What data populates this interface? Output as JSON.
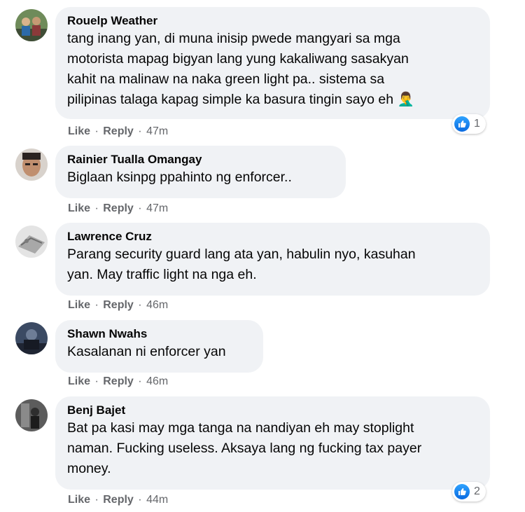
{
  "comments": [
    {
      "author": "Rouelp Weather",
      "text": "tang inang yan, di muna inisip pwede mangyari sa mga\nmotorista mapag bigyan lang yung kakaliwang sasakyan\nkahit na malinaw na naka green light pa.. sistema sa\npilipinas talaga kapag simple ka basura tingin sayo eh",
      "emoji": "🤦‍♂️",
      "time": "47m",
      "reactions": "1",
      "avatar_color": "#5b6e4e"
    },
    {
      "author": "Rainier Tualla Omangay",
      "text": "Biglaan ksinpg ppahinto ng enforcer..",
      "time": "47m",
      "avatar_color": "#b9876a"
    },
    {
      "author": "Lawrence Cruz",
      "text": "Parang security guard lang ata yan, habulin nyo, kasuhan\nyan. May traffic light na nga eh.",
      "time": "46m",
      "avatar_color": "#c9c9c9"
    },
    {
      "author": "Shawn Nwahs",
      "text": "Kasalanan ni enforcer yan",
      "time": "46m",
      "avatar_color": "#2e3546"
    },
    {
      "author": "Benj Bajet",
      "text": "Bat pa kasi may mga tanga na nandiyan eh may stoplight\nnaman. Fucking useless. Aksaya lang ng fucking tax payer\nmoney.",
      "time": "44m",
      "reactions": "2",
      "avatar_color": "#4a4a4a"
    }
  ],
  "actions": {
    "like": "Like",
    "reply": "Reply",
    "dot": "·"
  },
  "colors": {
    "bubble": "#f0f2f5",
    "meta": "#65676b",
    "like_blue": "#1877f2"
  },
  "icons": [
    "like-icon",
    "facepalm-emoji"
  ]
}
